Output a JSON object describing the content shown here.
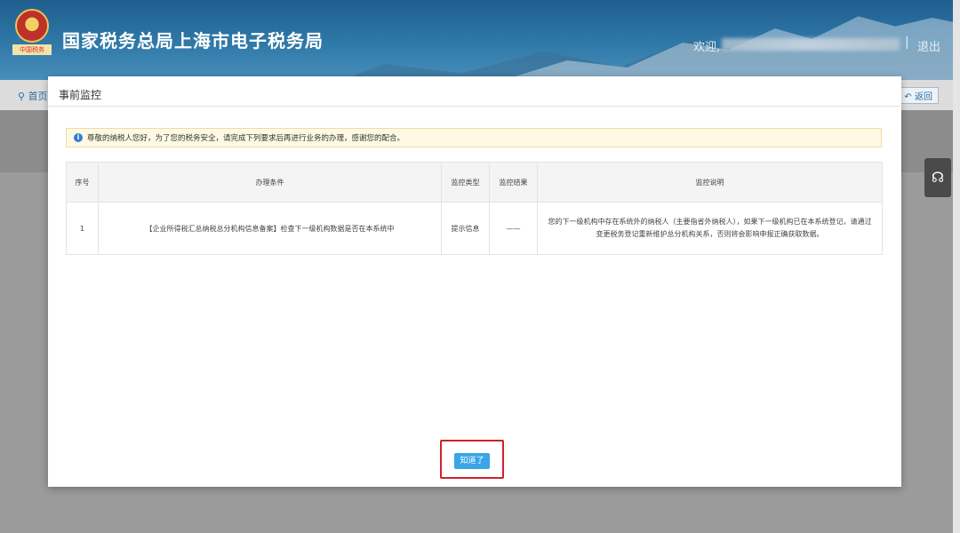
{
  "header": {
    "site_title": "国家税务总局上海市电子税务局",
    "emblem_caption": "中国税务",
    "welcome": "欢迎,",
    "separator": "|",
    "logout": "退出"
  },
  "nav": {
    "home": "首页",
    "back": "返回"
  },
  "modal": {
    "title": "事前监控",
    "notice": "尊敬的纳税人您好，为了您的税务安全，请完成下列要求后再进行业务的办理，感谢您的配合。",
    "table": {
      "headers": [
        "序号",
        "办理条件",
        "监控类型",
        "监控结果",
        "监控说明"
      ],
      "rows": [
        {
          "index": "1",
          "condition": "【企业所得税汇总纳税总分机构信息备案】检查下一级机构数据是否在本系统中",
          "type": "提示信息",
          "result": "——",
          "description": "您的下一级机构中存在系统外的纳税人（主要指省外纳税人），如果下一级机构已在本系统登记，请通过变更税务登记重新维护总分机构关系，否则将会影响申报正确获取数据。"
        }
      ]
    },
    "confirm_button": "知道了"
  },
  "colors": {
    "header": "#2f79a8",
    "accent_button": "#3aa5e8",
    "highlight_border": "#d0222b",
    "notice_bg": "#fdf9e3"
  }
}
